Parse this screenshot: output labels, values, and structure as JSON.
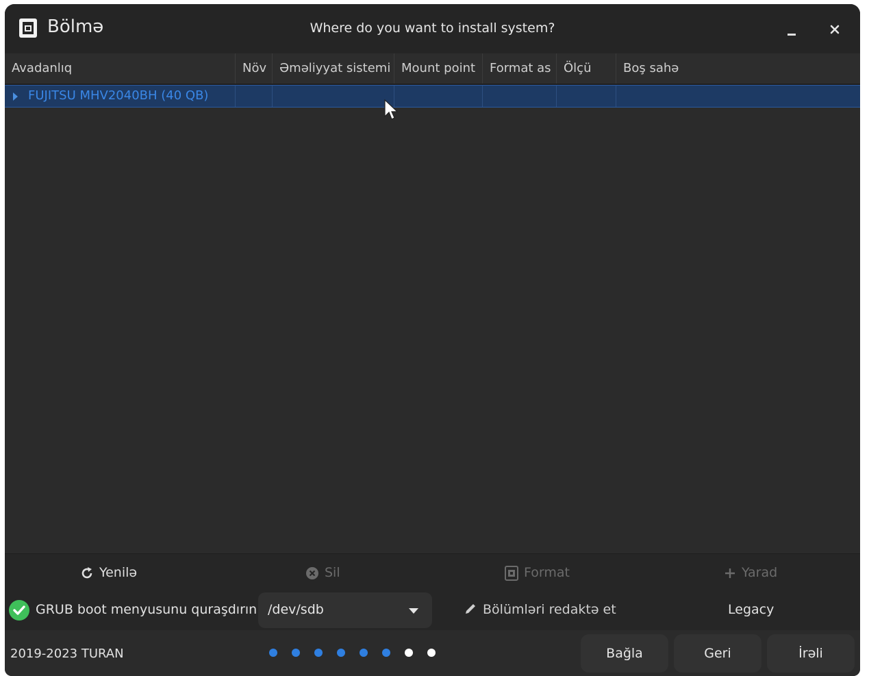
{
  "window": {
    "title": "Bölmə",
    "heading": "Where do you want to install system?",
    "minimize_label": "–",
    "close_label": "×"
  },
  "table": {
    "columns": [
      "Avadanlıq",
      "Növ",
      "Əməliyyat sistemi",
      "Mount point",
      "Format as",
      "Ölçü",
      "Boş sahə"
    ],
    "rows": [
      {
        "device": "FUJITSU MHV2040BH (40 QB)",
        "type": "",
        "os": "",
        "mount": "",
        "format": "",
        "size": "",
        "free": ""
      }
    ]
  },
  "toolbar": {
    "refresh": "Yenilə",
    "delete": "Sil",
    "format": "Format",
    "create": "Yarad"
  },
  "grub": {
    "label": "GRUB boot menyusunu quraşdırın:",
    "checked": true,
    "device_value": "/dev/sdb",
    "edit_partitions": "Bölümləri redaktə et",
    "mode": "Legacy"
  },
  "footer": {
    "copyright": "2019-2023 TURAN",
    "steps_total": 8,
    "steps_completed": 6,
    "connect_button": "Bağla",
    "back_button": "Geri",
    "next_button": "İrəli"
  },
  "colors": {
    "accent": "#2f7fe0",
    "selected_row": "#1d3a64",
    "success": "#3fbf5a",
    "inactive_dot": "#ffffff"
  }
}
